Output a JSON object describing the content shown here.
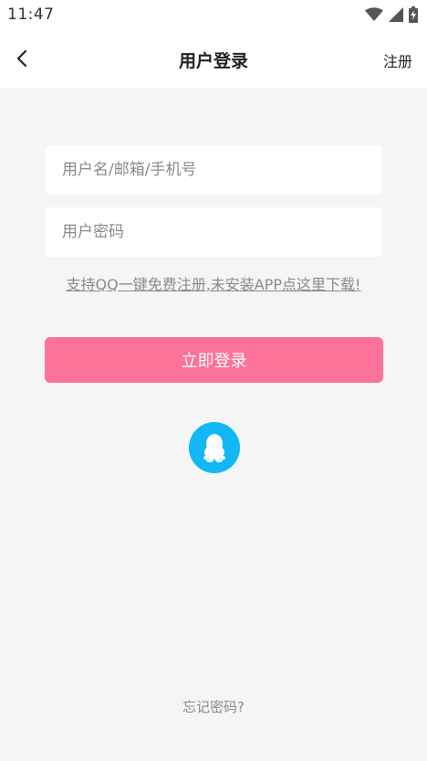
{
  "status_bar": {
    "time": "11:47",
    "icons": [
      "wifi-icon",
      "cell-signal-icon",
      "battery-charging-icon"
    ]
  },
  "nav": {
    "title": "用户登录",
    "right_action": "注册",
    "back_icon": "chevron-left-icon"
  },
  "form": {
    "username_placeholder": "用户名/邮箱/手机号",
    "username_value": "",
    "password_placeholder": "用户密码",
    "password_value": ""
  },
  "qq_hint": "支持QQ一键免费注册,未安装APP点这里下载!",
  "login_button": "立即登录",
  "qq_login_icon": "qq-icon",
  "forgot_password": "忘记密码?",
  "colors": {
    "accent": "#fd7298",
    "qq_blue": "#12b7f5",
    "background": "#f5f5f5"
  }
}
